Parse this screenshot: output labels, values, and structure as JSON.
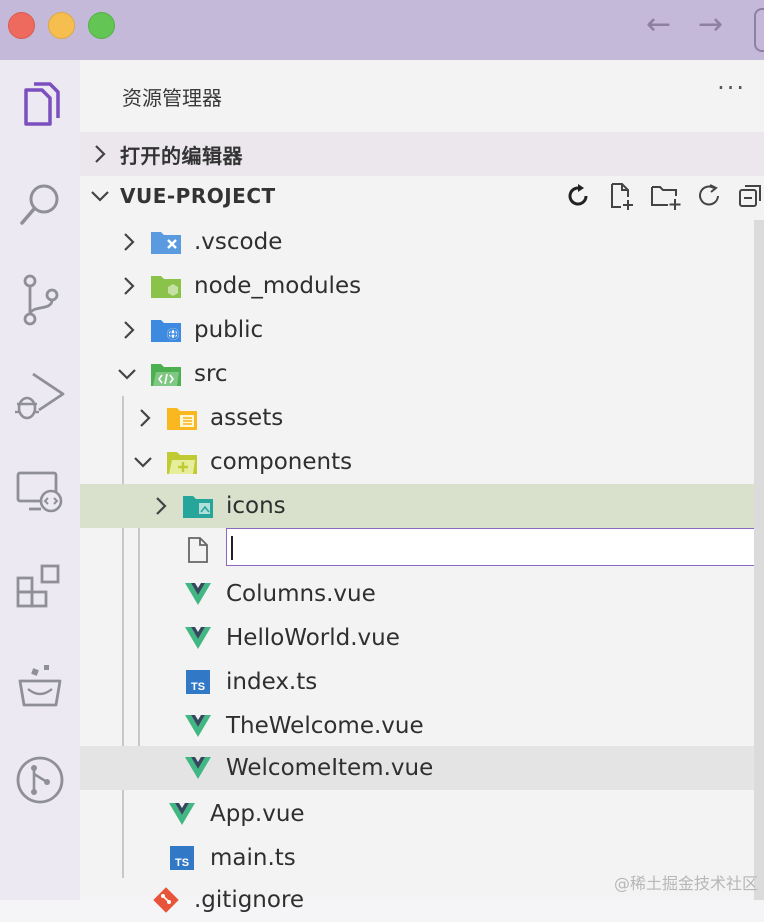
{
  "window": {
    "back_arrow": "←",
    "forward_arrow": "→"
  },
  "activity_bar": {
    "items": [
      {
        "name": "explorer",
        "icon": "files-icon",
        "active": true
      },
      {
        "name": "search",
        "icon": "search-icon"
      },
      {
        "name": "source-control",
        "icon": "source-control-icon"
      },
      {
        "name": "run-debug",
        "icon": "run-debug-icon"
      },
      {
        "name": "remote-explorer",
        "icon": "remote-explorer-icon"
      },
      {
        "name": "extensions",
        "icon": "extensions-icon"
      },
      {
        "name": "extension-basket",
        "icon": "basket-icon"
      },
      {
        "name": "git-graph",
        "icon": "git-graph-icon"
      }
    ]
  },
  "explorer": {
    "title": "资源管理器",
    "more": "···",
    "open_editors": "打开的编辑器",
    "project": "VUE-PROJECT",
    "project_actions": [
      "refresh-sync-icon",
      "new-file-icon",
      "new-folder-icon",
      "refresh-icon",
      "collapse-all-icon"
    ],
    "tree": [
      {
        "label": ".vscode",
        "type": "folder",
        "icon": "vscode-folder-icon",
        "expanded": false
      },
      {
        "label": "node_modules",
        "type": "folder",
        "icon": "node-folder-icon",
        "expanded": false
      },
      {
        "label": "public",
        "type": "folder",
        "icon": "public-folder-icon",
        "expanded": false
      },
      {
        "label": "src",
        "type": "folder",
        "icon": "src-folder-icon",
        "expanded": true
      },
      {
        "label": "assets",
        "type": "folder",
        "icon": "assets-folder-icon",
        "expanded": false
      },
      {
        "label": "components",
        "type": "folder",
        "icon": "components-folder-icon",
        "expanded": true
      },
      {
        "label": "icons",
        "type": "folder",
        "icon": "icons-folder-icon",
        "expanded": false,
        "selected": true
      },
      {
        "label": "",
        "type": "new-file-input",
        "icon": "file-icon"
      },
      {
        "label": "Columns.vue",
        "type": "file",
        "icon": "vue-icon"
      },
      {
        "label": "HelloWorld.vue",
        "type": "file",
        "icon": "vue-icon"
      },
      {
        "label": "index.ts",
        "type": "file",
        "icon": "ts-icon"
      },
      {
        "label": "TheWelcome.vue",
        "type": "file",
        "icon": "vue-icon"
      },
      {
        "label": "WelcomeItem.vue",
        "type": "file",
        "icon": "vue-icon",
        "hovered": true
      },
      {
        "label": "App.vue",
        "type": "file",
        "icon": "vue-icon"
      },
      {
        "label": "main.ts",
        "type": "file",
        "icon": "ts-icon"
      },
      {
        "label": ".gitignore",
        "type": "file",
        "icon": "git-icon"
      }
    ],
    "new_file_value": ""
  },
  "watermark": "@稀土掘金技术社区",
  "colors": {
    "titlebar": "#c5b9d9",
    "accent": "#8a68c0",
    "vue_green": "#41b883",
    "vue_dark": "#35495e",
    "ts_blue": "#3178c6",
    "selection": "#d9e0cc"
  }
}
